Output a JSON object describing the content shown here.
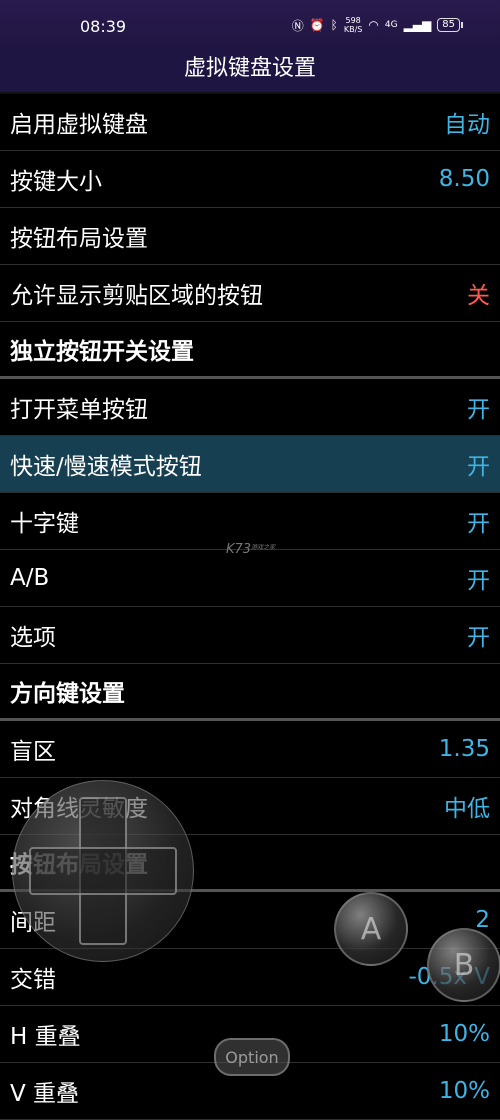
{
  "status": {
    "time": "08:39",
    "speed_top": "598",
    "speed_bottom": "KB/S",
    "network": "4G",
    "battery": "85"
  },
  "title": "虚拟键盘设置",
  "rows": [
    {
      "label": "启用虚拟键盘",
      "value": "自动",
      "type": "item"
    },
    {
      "label": "按键大小",
      "value": "8.50",
      "type": "item"
    },
    {
      "label": "按钮布局设置",
      "value": "",
      "type": "item"
    },
    {
      "label": "允许显示剪贴区域的按钮",
      "value": "关",
      "type": "item",
      "value_color": "#ff5a4e"
    },
    {
      "label": "独立按钮开关设置",
      "value": "",
      "type": "section"
    },
    {
      "label": "打开菜单按钮",
      "value": "开",
      "type": "item"
    },
    {
      "label": "快速/慢速模式按钮",
      "value": "开",
      "type": "item",
      "highlighted": true
    },
    {
      "label": "十字键",
      "value": "开",
      "type": "item"
    },
    {
      "label": "A/B",
      "value": "开",
      "type": "item"
    },
    {
      "label": "选项",
      "value": "开",
      "type": "item"
    },
    {
      "label": "方向键设置",
      "value": "",
      "type": "section"
    },
    {
      "label": "盲区",
      "value": "1.35",
      "type": "item"
    },
    {
      "label": "对角线灵敏度",
      "value": "中低",
      "type": "item"
    },
    {
      "label": "按钮布局设置",
      "value": "",
      "type": "section"
    },
    {
      "label": "间距",
      "value": "2",
      "type": "item"
    },
    {
      "label": "交错",
      "value": "-0.5x V",
      "type": "item"
    },
    {
      "label": "H 重叠",
      "value": "10%",
      "type": "item"
    },
    {
      "label": "V 重叠",
      "value": "10%",
      "type": "item"
    }
  ],
  "overlay": {
    "button_a": "A",
    "button_b": "B",
    "button_option": "Option"
  },
  "watermark": {
    "text": "K73",
    "sub": "游戏之家"
  },
  "colors": {
    "accent": "#3fb5e6",
    "off": "#ff5a4e",
    "highlight": "#163f52",
    "header": "#1f1542"
  }
}
